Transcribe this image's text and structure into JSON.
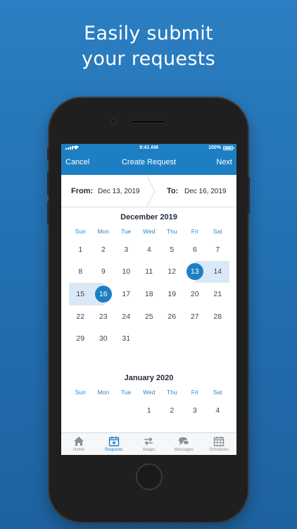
{
  "headline": {
    "line1": "Easily submit",
    "line2": "your requests"
  },
  "status_bar": {
    "time": "9:41 AM",
    "battery": "100%"
  },
  "nav": {
    "cancel": "Cancel",
    "title": "Create Request",
    "next": "Next"
  },
  "date_range": {
    "from_label": "From:",
    "from_value": "Dec 13, 2019",
    "to_label": "To:",
    "to_value": "Dec 16, 2019"
  },
  "weekdays": [
    "Sun",
    "Mon",
    "Tue",
    "Wed",
    "Thu",
    "Fri",
    "Sat"
  ],
  "months": [
    {
      "title": "December 2019",
      "days": [
        "1",
        "2",
        "3",
        "4",
        "5",
        "6",
        "7",
        "8",
        "9",
        "10",
        "11",
        "12",
        "13",
        "14",
        "15",
        "16",
        "17",
        "18",
        "19",
        "20",
        "21",
        "22",
        "23",
        "24",
        "25",
        "26",
        "27",
        "28",
        "29",
        "30",
        "31"
      ],
      "range_start": "13",
      "range_end": "16"
    },
    {
      "title": "January 2020",
      "visible_days": [
        "1",
        "2",
        "3",
        "4"
      ]
    }
  ],
  "tabs": [
    {
      "label": "Home",
      "icon": "home-icon",
      "active": false
    },
    {
      "label": "Requests",
      "icon": "calendar-plus-icon",
      "active": true
    },
    {
      "label": "Swaps",
      "icon": "swap-arrows-icon",
      "active": false
    },
    {
      "label": "Messages",
      "icon": "chat-bubbles-icon",
      "active": false
    },
    {
      "label": "Schedules",
      "icon": "calendar-grid-icon",
      "active": false
    }
  ],
  "colors": {
    "accent": "#1d7fc3",
    "range_fill": "#dbe9f6",
    "background": "#2371b3"
  }
}
